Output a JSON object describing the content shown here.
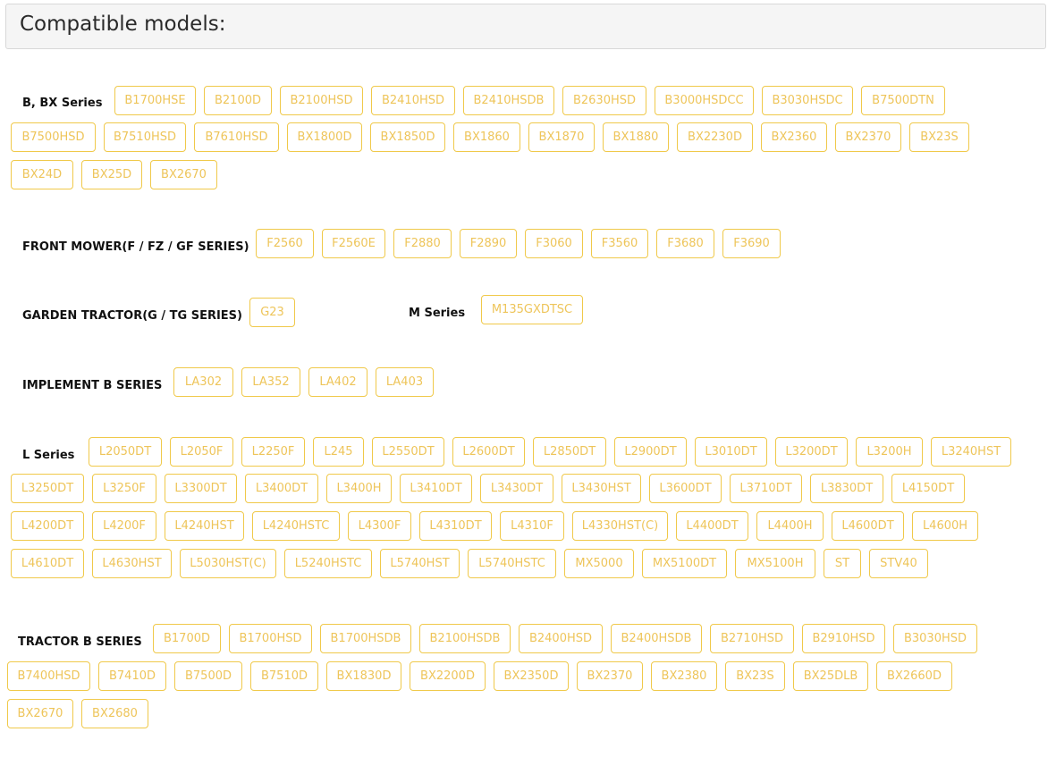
{
  "header": {
    "title": "Compatible models:"
  },
  "sections": [
    {
      "label": "B, BX Series",
      "models": [
        "B1700HSE",
        "B2100D",
        "B2100HSD",
        "B2410HSD",
        "B2410HSDB",
        "B2630HSD",
        "B3000HSDCC",
        "B3030HSDC",
        "B7500DTN",
        "B7500HSD",
        "B7510HSD",
        "B7610HSD",
        "BX1800D",
        "BX1850D",
        "BX1860",
        "BX1870",
        "BX1880",
        "BX2230D",
        "BX2360",
        "BX2370",
        "BX23S",
        "BX24D",
        "BX25D",
        "BX2670"
      ]
    },
    {
      "label": "FRONT MOWER(F / FZ / GF SERIES)",
      "models": [
        "F2560",
        "F2560E",
        "F2880",
        "F2890",
        "F3060",
        "F3560",
        "F3680",
        "F3690"
      ]
    },
    {
      "label": "GARDEN TRACTOR(G / TG SERIES)",
      "models": [
        "G23"
      ]
    },
    {
      "label": "M Series",
      "models": [
        "M135GXDTSC"
      ]
    },
    {
      "label": "IMPLEMENT B SERIES",
      "models": [
        "LA302",
        "LA352",
        "LA402",
        "LA403"
      ]
    },
    {
      "label": "L Series",
      "models": [
        "L2050DT",
        "L2050F",
        "L2250F",
        "L245",
        "L2550DT",
        "L2600DT",
        "L2850DT",
        "L2900DT",
        "L3010DT",
        "L3200DT",
        "L3200H",
        "L3240HST",
        "L3250DT",
        "L3250F",
        "L3300DT",
        "L3400DT",
        "L3400H",
        "L3410DT",
        "L3430DT",
        "L3430HST",
        "L3600DT",
        "L3710DT",
        "L3830DT",
        "L4150DT",
        "L4200DT",
        "L4200F",
        "L4240HST",
        "L4240HSTC",
        "L4300F",
        "L4310DT",
        "L4310F",
        "L4330HST(C)",
        "L4400DT",
        "L4400H",
        "L4600DT",
        "L4600H",
        "L4610DT",
        "L4630HST",
        "L5030HST(C)",
        "L5240HSTC",
        "L5740HST",
        "L5740HSTC",
        "MX5000",
        "MX5100DT",
        "MX5100H",
        "ST",
        "STV40"
      ]
    },
    {
      "label": "TRACTOR B SERIES",
      "models": [
        "B1700D",
        "B1700HSD",
        "B1700HSDB",
        "B2100HSDB",
        "B2400HSD",
        "B2400HSDB",
        "B2710HSD",
        "B2910HSD",
        "B3030HSD",
        "B7400HSD",
        "B7410D",
        "B7500D",
        "B7510D",
        "BX1830D",
        "BX2200D",
        "BX2350D",
        "BX2370",
        "BX2380",
        "BX23S",
        "BX25DLB",
        "BX2660D",
        "BX2670",
        "BX2680"
      ]
    }
  ]
}
